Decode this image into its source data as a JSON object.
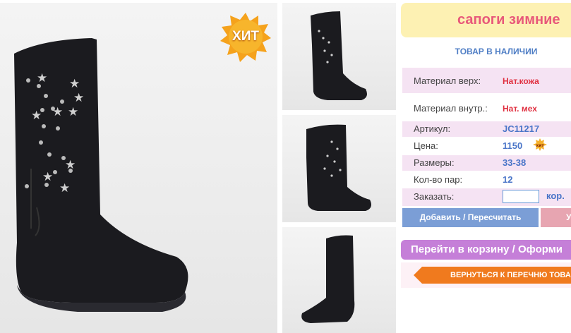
{
  "badge": {
    "hit_label": "ХИТ",
    "mini_hit_label": "хит"
  },
  "product": {
    "title": "сапоги зимние",
    "availability": "ТОВАР В НАЛИЧИИ"
  },
  "specs": {
    "material_top_label": "Материал верх:",
    "material_top_value": "Нат.кожа",
    "material_inner_label": "Материал внутр.:",
    "material_inner_value": "Нат. мех",
    "article_label": "Артикул:",
    "article_value": "JC11217",
    "price_label": "Цена:",
    "price_value": "1150",
    "sizes_label": "Размеры:",
    "sizes_value": "33-38",
    "pairs_label": "Кол-во пар:",
    "pairs_value": "12",
    "order_label": "Заказать:",
    "order_unit": "кор."
  },
  "actions": {
    "add_label": "Добавить / Пересчитать",
    "second_label": "У",
    "cart_label": "Перейти в корзину / Оформи",
    "back_label": "ВЕРНУТЬСЯ К ПЕРЕЧНЮ ТОВА"
  },
  "colors": {
    "title_bg": "#fdf1b3",
    "title_text": "#e8587a",
    "accent_blue": "#4a75c8",
    "cart_purple": "#c57fd8",
    "back_orange": "#f07a1e"
  }
}
